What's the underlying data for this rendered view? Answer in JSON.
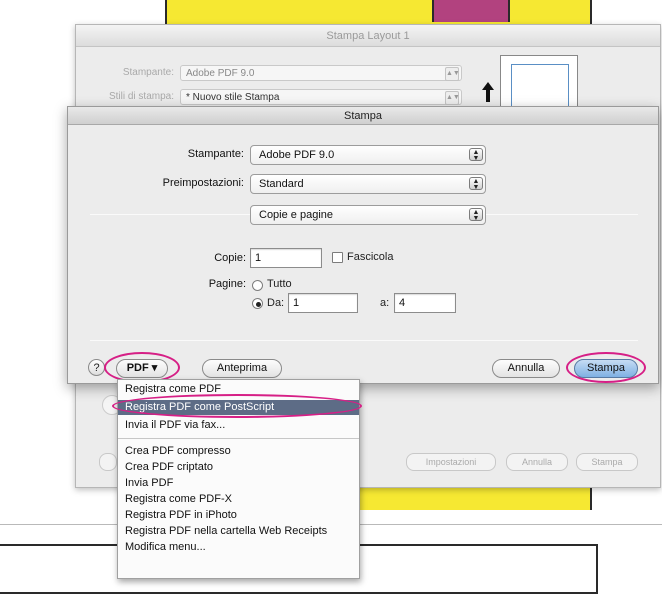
{
  "back_dialog": {
    "title": "Stampa Layout 1",
    "printer_label": "Stampante:",
    "printer_value": "Adobe PDF 9.0",
    "style_label": "Stili di stampa:",
    "style_value": "* Nuovo stile Stampa",
    "bottom_buttons": [
      "Impostazioni",
      "Annulla",
      "Stampa"
    ]
  },
  "print_dialog": {
    "title": "Stampa",
    "printer_label": "Stampante:",
    "printer_value": "Adobe PDF 9.0",
    "presets_label": "Preimpostazioni:",
    "presets_value": "Standard",
    "section_value": "Copie e pagine",
    "copies_label": "Copie:",
    "copies_value": "1",
    "collate_label": "Fascicola",
    "pages_label": "Pagine:",
    "all_label": "Tutto",
    "from_label": "Da:",
    "from_value": "1",
    "to_label": "a:",
    "to_value": "4",
    "help_label": "?",
    "pdf_label": "PDF ▾",
    "preview_label": "Anteprima",
    "cancel_label": "Annulla",
    "print_label": "Stampa"
  },
  "pdf_menu": {
    "items": [
      "Registra come PDF",
      "Registra PDF come PostScript",
      "Invia il PDF via fax...",
      "Crea PDF compresso",
      "Crea PDF criptato",
      "Invia PDF",
      "Registra come PDF-X",
      "Registra PDF in iPhoto",
      "Registra PDF nella cartella Web Receipts",
      "Modifica menu..."
    ],
    "highlighted_index": 1
  },
  "colors": {
    "highlight_ring": "#d61f86",
    "background_yellow": "#f6e832",
    "background_magenta": "#b2427f",
    "menu_highlight": "#5d6c86"
  }
}
